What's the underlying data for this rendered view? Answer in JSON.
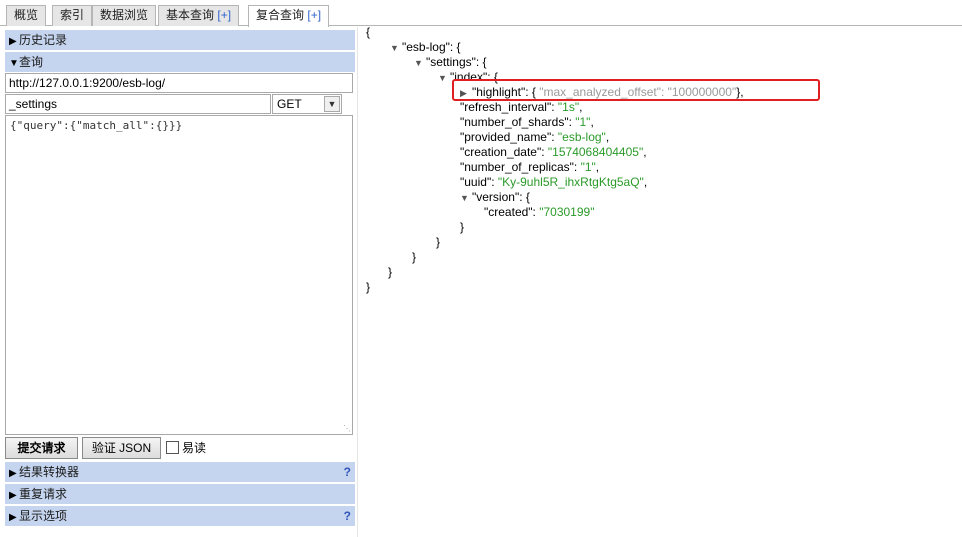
{
  "tabs": [
    {
      "label": "概览",
      "active": false
    },
    {
      "label": "索引",
      "active": false
    },
    {
      "label": "数据浏览",
      "active": false
    },
    {
      "label": "基本查询",
      "plus": "[+]",
      "active": false
    },
    {
      "label": "复合查询",
      "plus": "[+]",
      "active": true
    }
  ],
  "left": {
    "history_label": "历史记录",
    "query_label": "查询",
    "url_value": "http://127.0.0.1:9200/esb-log/",
    "path_value": "_settings",
    "method_value": "GET",
    "body_value": "{\"query\":{\"match_all\":{}}}",
    "submit_label": "提交请求",
    "validate_label": "验证 JSON",
    "easy_read_label": "易读",
    "transformer_label": "结果转换器",
    "repeat_label": "重复请求",
    "display_label": "显示选项",
    "help_mark": "?"
  },
  "json": {
    "open_brace": "{",
    "esb_key": "\"esb-log\": {",
    "settings_key": "\"settings\": {",
    "index_key": "\"index\": {",
    "highlight_key": "\"highlight\":",
    "highlight_open": " { ",
    "max_offset_pair": "\"max_analyzed_offset\": \"100000000\"",
    "highlight_close": "},",
    "refresh_key": "\"refresh_interval\": ",
    "refresh_val": "\"1s\"",
    "shards_key": "\"number_of_shards\": ",
    "shards_val": "\"1\"",
    "provided_key": "\"provided_name\": ",
    "provided_val": "\"esb-log\"",
    "creation_key": "\"creation_date\": ",
    "creation_val": "\"1574068404405\"",
    "replicas_key": "\"number_of_replicas\": ",
    "replicas_val": "\"1\"",
    "uuid_key": "\"uuid\": ",
    "uuid_val": "\"Ky-9uhl5R_ihxRtgKtg5aQ\"",
    "version_key": "\"version\": {",
    "created_key": "\"created\": ",
    "created_val": "\"7030199\"",
    "close_brace": "}",
    "comma": ",",
    "expand_icon": "collapse-triangle",
    "collapsed_icon": "expand-triangle"
  }
}
